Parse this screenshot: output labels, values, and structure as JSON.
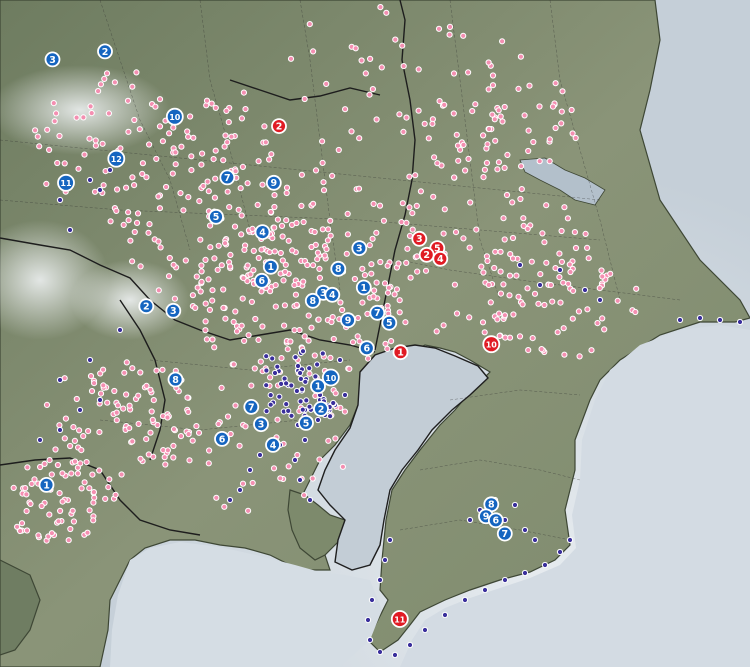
{
  "colors": {
    "sea": "#cdd6de",
    "sea_deep": "#b9c5d0",
    "land": "#7f8b6f",
    "land_dark": "#55624a",
    "mountain_haze": "#dfe5e7",
    "boundary": "#2b2b2b",
    "pink_dot": "#f48fb1",
    "purple_dot": "#3a2f9c",
    "blue_badge": "#1565c0",
    "red_badge": "#e01b24"
  },
  "legend": {
    "pink_dot": "station-marker",
    "purple_dot": "coastal-marker"
  },
  "blue_badges": [
    "1",
    "2",
    "3",
    "4",
    "5",
    "6",
    "7",
    "8",
    "9",
    "10",
    "11",
    "12"
  ],
  "red_badges": [
    "1",
    "2",
    "3",
    "4",
    "5",
    "10",
    "11"
  ],
  "badges": [
    {
      "label": "3",
      "kind": "blue",
      "lon": 0.07,
      "lat": 0.089
    },
    {
      "label": "2",
      "kind": "blue",
      "lon": 0.14,
      "lat": 0.077
    },
    {
      "label": "10",
      "kind": "blue",
      "lon": 0.233,
      "lat": 0.175
    },
    {
      "label": "12",
      "kind": "blue",
      "lon": 0.155,
      "lat": 0.238
    },
    {
      "label": "11",
      "kind": "blue",
      "lon": 0.088,
      "lat": 0.274
    },
    {
      "label": "7",
      "kind": "blue",
      "lon": 0.303,
      "lat": 0.266
    },
    {
      "label": "9",
      "kind": "blue",
      "lon": 0.365,
      "lat": 0.274
    },
    {
      "label": "5",
      "kind": "blue",
      "lon": 0.288,
      "lat": 0.325
    },
    {
      "label": "4",
      "kind": "blue",
      "lon": 0.35,
      "lat": 0.348
    },
    {
      "label": "3",
      "kind": "blue",
      "lon": 0.479,
      "lat": 0.372
    },
    {
      "label": "1",
      "kind": "blue",
      "lon": 0.361,
      "lat": 0.4
    },
    {
      "label": "8",
      "kind": "blue",
      "lon": 0.451,
      "lat": 0.403
    },
    {
      "label": "6",
      "kind": "blue",
      "lon": 0.349,
      "lat": 0.421
    },
    {
      "label": "3",
      "kind": "blue",
      "lon": 0.431,
      "lat": 0.439
    },
    {
      "label": "1",
      "kind": "blue",
      "lon": 0.485,
      "lat": 0.431
    },
    {
      "label": "4",
      "kind": "blue",
      "lon": 0.443,
      "lat": 0.442
    },
    {
      "label": "8",
      "kind": "blue",
      "lon": 0.417,
      "lat": 0.451
    },
    {
      "label": "2",
      "kind": "blue",
      "lon": 0.195,
      "lat": 0.459
    },
    {
      "label": "3",
      "kind": "blue",
      "lon": 0.231,
      "lat": 0.466
    },
    {
      "label": "9",
      "kind": "blue",
      "lon": 0.464,
      "lat": 0.48
    },
    {
      "label": "7",
      "kind": "blue",
      "lon": 0.503,
      "lat": 0.469
    },
    {
      "label": "5",
      "kind": "blue",
      "lon": 0.519,
      "lat": 0.484
    },
    {
      "label": "6",
      "kind": "blue",
      "lon": 0.489,
      "lat": 0.522
    },
    {
      "label": "10",
      "kind": "blue",
      "lon": 0.441,
      "lat": 0.566
    },
    {
      "label": "1",
      "kind": "blue",
      "lon": 0.424,
      "lat": 0.579
    },
    {
      "label": "8",
      "kind": "blue",
      "lon": 0.234,
      "lat": 0.569
    },
    {
      "label": "2",
      "kind": "blue",
      "lon": 0.428,
      "lat": 0.613
    },
    {
      "label": "7",
      "kind": "blue",
      "lon": 0.335,
      "lat": 0.61
    },
    {
      "label": "3",
      "kind": "blue",
      "lon": 0.348,
      "lat": 0.636
    },
    {
      "label": "5",
      "kind": "blue",
      "lon": 0.408,
      "lat": 0.634
    },
    {
      "label": "6",
      "kind": "blue",
      "lon": 0.296,
      "lat": 0.658
    },
    {
      "label": "4",
      "kind": "blue",
      "lon": 0.364,
      "lat": 0.667
    },
    {
      "label": "1",
      "kind": "blue",
      "lon": 0.062,
      "lat": 0.727
    },
    {
      "label": "8",
      "kind": "blue",
      "lon": 0.655,
      "lat": 0.756
    },
    {
      "label": "9",
      "kind": "blue",
      "lon": 0.648,
      "lat": 0.774
    },
    {
      "label": "6",
      "kind": "blue",
      "lon": 0.661,
      "lat": 0.78
    },
    {
      "label": "7",
      "kind": "blue",
      "lon": 0.673,
      "lat": 0.8
    },
    {
      "label": "2",
      "kind": "red",
      "lon": 0.372,
      "lat": 0.189
    },
    {
      "label": "3",
      "kind": "red",
      "lon": 0.559,
      "lat": 0.358
    },
    {
      "label": "5",
      "kind": "red",
      "lon": 0.583,
      "lat": 0.372
    },
    {
      "label": "2",
      "kind": "red",
      "lon": 0.569,
      "lat": 0.382
    },
    {
      "label": "4",
      "kind": "red",
      "lon": 0.587,
      "lat": 0.388
    },
    {
      "label": "1",
      "kind": "red",
      "lon": 0.534,
      "lat": 0.528
    },
    {
      "label": "10",
      "kind": "red",
      "lon": 0.655,
      "lat": 0.516
    },
    {
      "label": "11",
      "kind": "red",
      "lon": 0.533,
      "lat": 0.928
    }
  ]
}
